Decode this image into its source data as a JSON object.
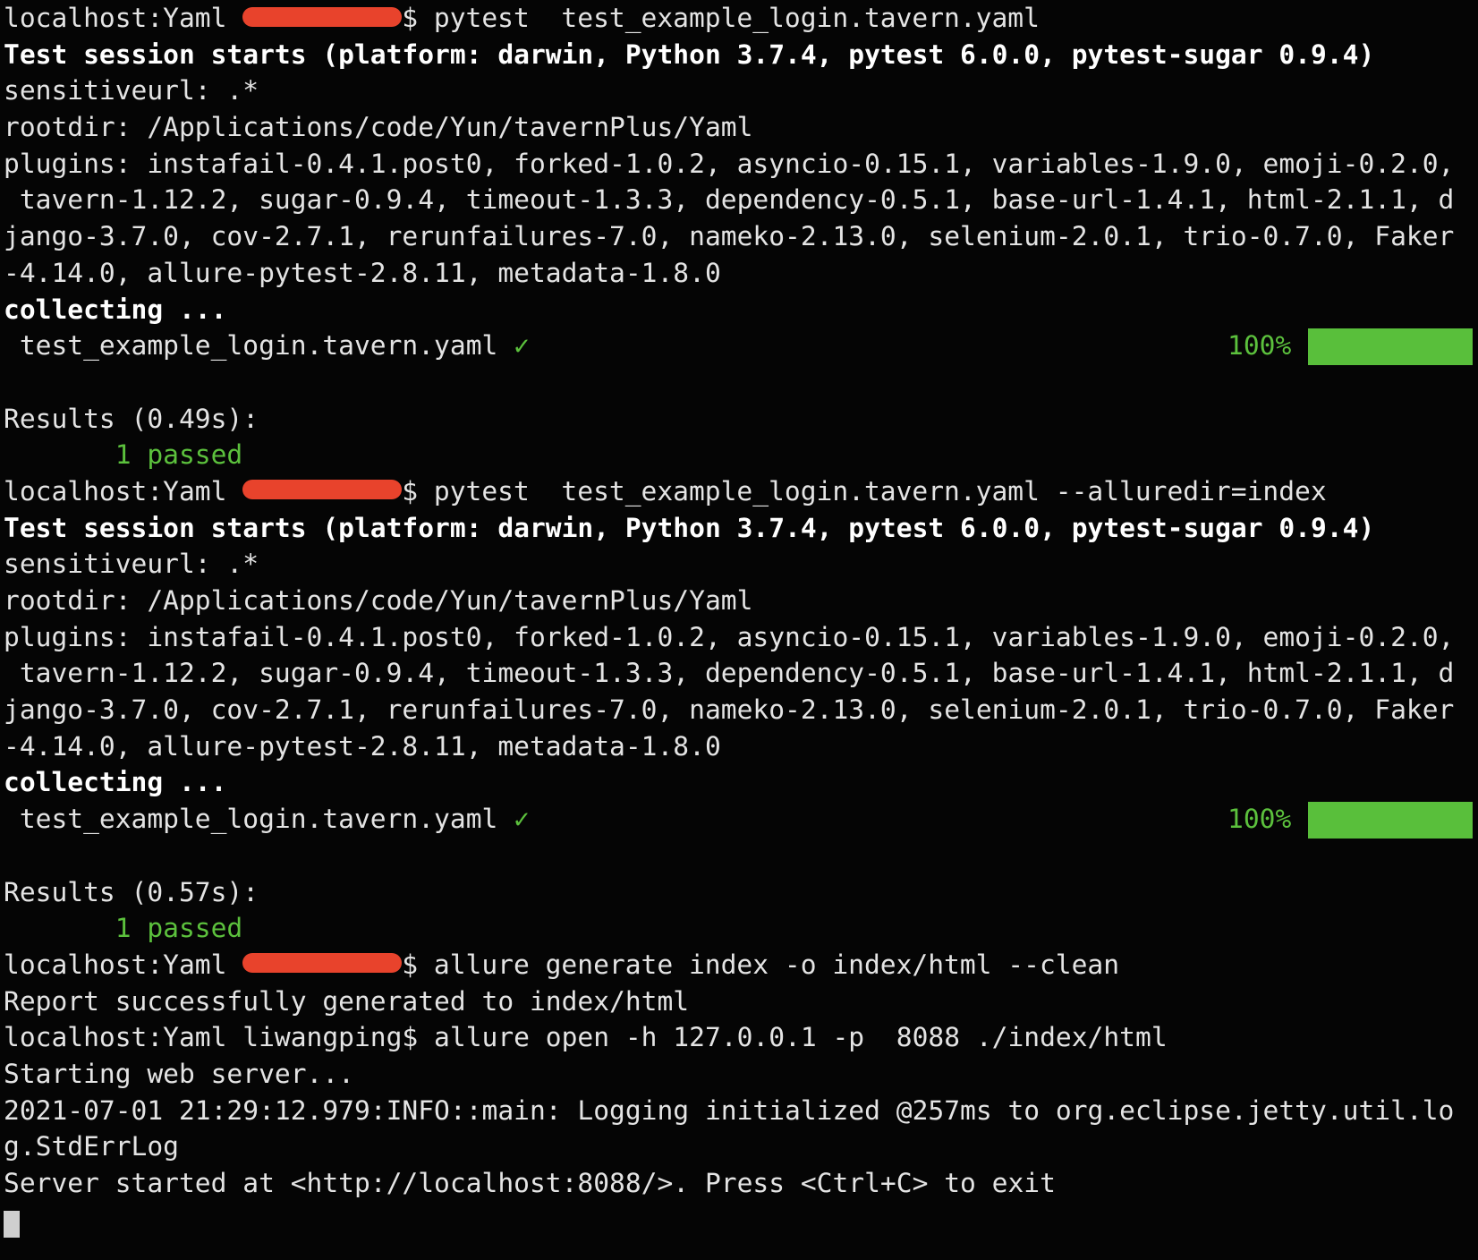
{
  "terminal": {
    "colors": {
      "text": "#e4e4e4",
      "success": "#5cc13d",
      "redaction": "#e8432c",
      "background": "#050505"
    },
    "lines": [
      {
        "segs": [
          {
            "t": "localhost:Yaml "
          },
          {
            "redact": 10
          },
          {
            "t": "$ pytest  test_example_login.tavern.yaml"
          }
        ]
      },
      {
        "segs": [
          {
            "t": "Test session starts (platform: darwin, Python 3.7.4, pytest 6.0.0, pytest-sugar 0.9.4)",
            "s": "bold"
          }
        ]
      },
      {
        "segs": [
          {
            "t": "sensitiveurl: .*"
          }
        ]
      },
      {
        "segs": [
          {
            "t": "rootdir: /Applications/code/Yun/tavernPlus/Yaml"
          }
        ]
      },
      {
        "segs": [
          {
            "t": "plugins: instafail-0.4.1.post0, forked-1.0.2, asyncio-0.15.1, variables-1.9.0, emoji-0.2.0,"
          }
        ]
      },
      {
        "segs": [
          {
            "t": " tavern-1.12.2, sugar-0.9.4, timeout-1.3.3, dependency-0.5.1, base-url-1.4.1, html-2.1.1, d"
          }
        ]
      },
      {
        "segs": [
          {
            "t": "jango-3.7.0, cov-2.7.1, rerunfailures-7.0, nameko-2.13.0, selenium-2.0.1, trio-0.7.0, Faker"
          }
        ]
      },
      {
        "segs": [
          {
            "t": "-4.14.0, allure-pytest-2.8.11, metadata-1.8.0"
          }
        ]
      },
      {
        "segs": [
          {
            "t": "collecting ...",
            "s": "bold"
          }
        ]
      },
      {
        "segs": [
          {
            "t": " test_example_login.tavern.yaml "
          },
          {
            "t": "✓",
            "s": "green"
          }
        ],
        "progress": {
          "label": "100%",
          "percent": 100
        }
      },
      {
        "segs": []
      },
      {
        "segs": [
          {
            "t": "Results (0.49s):"
          }
        ]
      },
      {
        "segs": [
          {
            "t": "       "
          },
          {
            "t": "1 passed",
            "s": "green"
          }
        ]
      },
      {
        "segs": [
          {
            "t": "localhost:Yaml "
          },
          {
            "redact": 10
          },
          {
            "t": "$ pytest  test_example_login.tavern.yaml --alluredir=index"
          }
        ]
      },
      {
        "segs": [
          {
            "t": "Test session starts (platform: darwin, Python 3.7.4, pytest 6.0.0, pytest-sugar 0.9.4)",
            "s": "bold"
          }
        ]
      },
      {
        "segs": [
          {
            "t": "sensitiveurl: .*"
          }
        ]
      },
      {
        "segs": [
          {
            "t": "rootdir: /Applications/code/Yun/tavernPlus/Yaml"
          }
        ]
      },
      {
        "segs": [
          {
            "t": "plugins: instafail-0.4.1.post0, forked-1.0.2, asyncio-0.15.1, variables-1.9.0, emoji-0.2.0,"
          }
        ]
      },
      {
        "segs": [
          {
            "t": " tavern-1.12.2, sugar-0.9.4, timeout-1.3.3, dependency-0.5.1, base-url-1.4.1, html-2.1.1, d"
          }
        ]
      },
      {
        "segs": [
          {
            "t": "jango-3.7.0, cov-2.7.1, rerunfailures-7.0, nameko-2.13.0, selenium-2.0.1, trio-0.7.0, Faker"
          }
        ]
      },
      {
        "segs": [
          {
            "t": "-4.14.0, allure-pytest-2.8.11, metadata-1.8.0"
          }
        ]
      },
      {
        "segs": [
          {
            "t": "collecting ...",
            "s": "bold"
          }
        ]
      },
      {
        "segs": [
          {
            "t": " test_example_login.tavern.yaml "
          },
          {
            "t": "✓",
            "s": "green"
          }
        ],
        "progress": {
          "label": "100%",
          "percent": 100
        }
      },
      {
        "segs": []
      },
      {
        "segs": [
          {
            "t": "Results (0.57s):"
          }
        ]
      },
      {
        "segs": [
          {
            "t": "       "
          },
          {
            "t": "1 passed",
            "s": "green"
          }
        ]
      },
      {
        "segs": [
          {
            "t": "localhost:Yaml "
          },
          {
            "redact": 10
          },
          {
            "t": "$ allure generate index -o index/html --clean"
          }
        ]
      },
      {
        "segs": [
          {
            "t": "Report successfully generated to index/html"
          }
        ]
      },
      {
        "segs": [
          {
            "t": "localhost:Yaml liwangping$ allure open -h 127.0.0.1 -p  8088 ./index/html"
          }
        ]
      },
      {
        "segs": [
          {
            "t": "Starting web server..."
          }
        ]
      },
      {
        "segs": [
          {
            "t": "2021-07-01 21:29:12.979:INFO::main: Logging initialized @257ms to org.eclipse.jetty.util.lo"
          }
        ]
      },
      {
        "segs": [
          {
            "t": "g.StdErrLog"
          }
        ]
      },
      {
        "segs": [
          {
            "t": "Server started at <http://localhost:8088/>. Press <Ctrl+C> to exit"
          }
        ]
      },
      {
        "segs": [],
        "cursor": true
      }
    ]
  }
}
